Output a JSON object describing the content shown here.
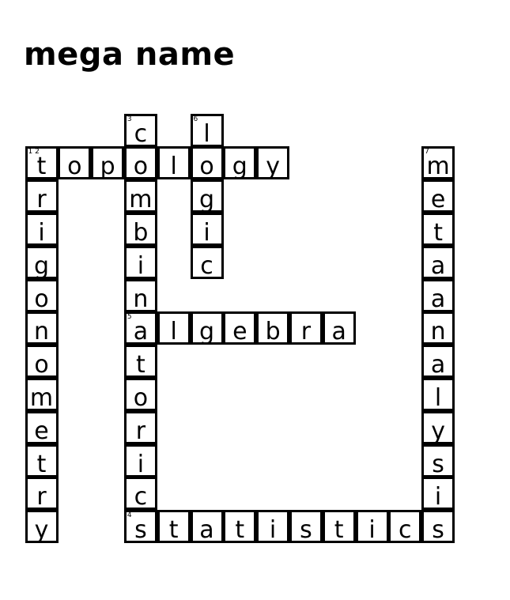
{
  "title": "mega name",
  "words": [
    {
      "number": "1",
      "answer": "trigonometry",
      "direction": "down",
      "row": 1,
      "col": 0
    },
    {
      "number": "2",
      "answer": "topology",
      "direction": "across",
      "row": 1,
      "col": 0
    },
    {
      "number": "3",
      "answer": "combinatorics",
      "direction": "down",
      "row": 0,
      "col": 3
    },
    {
      "number": "4",
      "answer": "statistics",
      "direction": "across",
      "row": 12,
      "col": 3
    },
    {
      "number": "5",
      "answer": "algebra",
      "direction": "across",
      "row": 6,
      "col": 3
    },
    {
      "number": "6",
      "answer": "logic",
      "direction": "down",
      "row": 0,
      "col": 5
    },
    {
      "number": "7",
      "answer": "metaanalysis",
      "direction": "down",
      "row": 1,
      "col": 12
    }
  ],
  "cell_labels": [
    {
      "row": 1,
      "col": 0,
      "label": "1 2"
    }
  ]
}
